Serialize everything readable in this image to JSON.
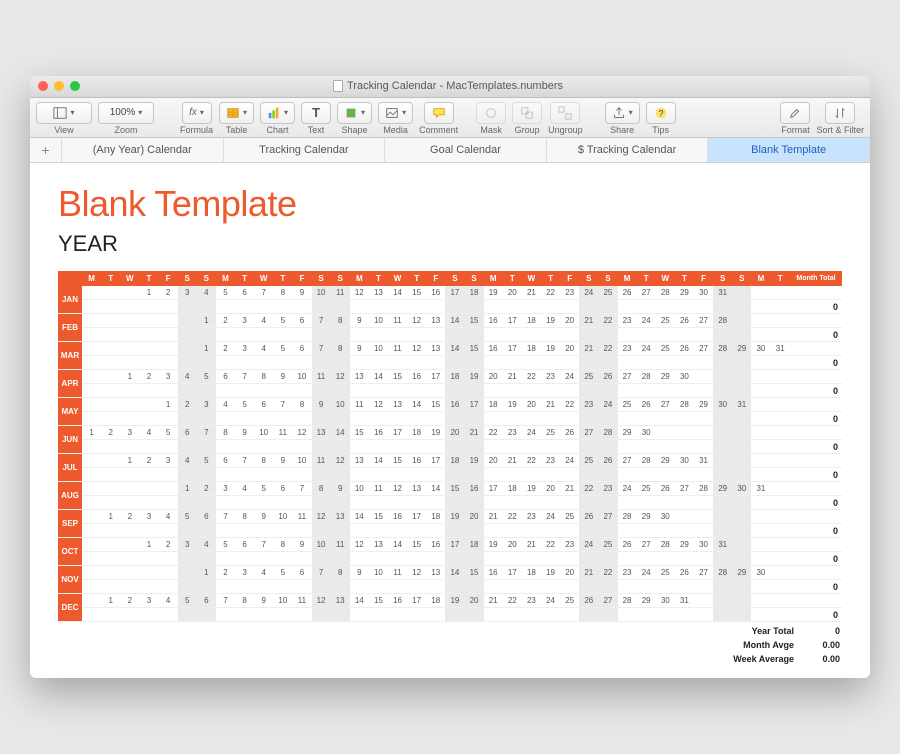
{
  "window": {
    "title": "Tracking Calendar - MacTemplates.numbers"
  },
  "toolbar": {
    "view": "View",
    "zoom": "Zoom",
    "zoomVal": "100%",
    "formula": "Formula",
    "table": "Table",
    "chart": "Chart",
    "text": "Text",
    "shape": "Shape",
    "media": "Media",
    "comment": "Comment",
    "mask": "Mask",
    "group": "Group",
    "ungroup": "Ungroup",
    "share": "Share",
    "tips": "Tips",
    "format": "Format",
    "sort": "Sort & Filter"
  },
  "tabs": {
    "items": [
      {
        "label": "(Any Year)  Calendar"
      },
      {
        "label": "Tracking Calendar"
      },
      {
        "label": "Goal Calendar"
      },
      {
        "label": "$ Tracking Calendar"
      },
      {
        "label": "Blank Template"
      }
    ],
    "activeIndex": 4
  },
  "page": {
    "title": "Blank Template",
    "subtitle": "YEAR"
  },
  "calendar": {
    "days": [
      "M",
      "T",
      "W",
      "T",
      "F",
      "S",
      "S"
    ],
    "monthTotalHeader": "Month Total",
    "months": [
      {
        "name": "JAN",
        "start": 3,
        "days": 31,
        "total": "0"
      },
      {
        "name": "FEB",
        "start": 6,
        "days": 28,
        "total": "0"
      },
      {
        "name": "MAR",
        "start": 6,
        "days": 31,
        "total": "0"
      },
      {
        "name": "APR",
        "start": 2,
        "days": 30,
        "total": "0"
      },
      {
        "name": "MAY",
        "start": 4,
        "days": 31,
        "total": "0"
      },
      {
        "name": "JUN",
        "start": 0,
        "days": 30,
        "total": "0"
      },
      {
        "name": "JUL",
        "start": 2,
        "days": 31,
        "total": "0"
      },
      {
        "name": "AUG",
        "start": 5,
        "days": 31,
        "total": "0"
      },
      {
        "name": "SEP",
        "start": 1,
        "days": 30,
        "total": "0"
      },
      {
        "name": "OCT",
        "start": 3,
        "days": 31,
        "total": "0"
      },
      {
        "name": "NOV",
        "start": 6,
        "days": 30,
        "total": "0"
      },
      {
        "name": "DEC",
        "start": 1,
        "days": 31,
        "total": "0"
      }
    ]
  },
  "summary": {
    "yearTotal": {
      "label": "Year Total",
      "value": "0"
    },
    "monthAvg": {
      "label": "Month Avge",
      "value": "0.00"
    },
    "weekAvg": {
      "label": "Week Average",
      "value": "0.00"
    }
  }
}
